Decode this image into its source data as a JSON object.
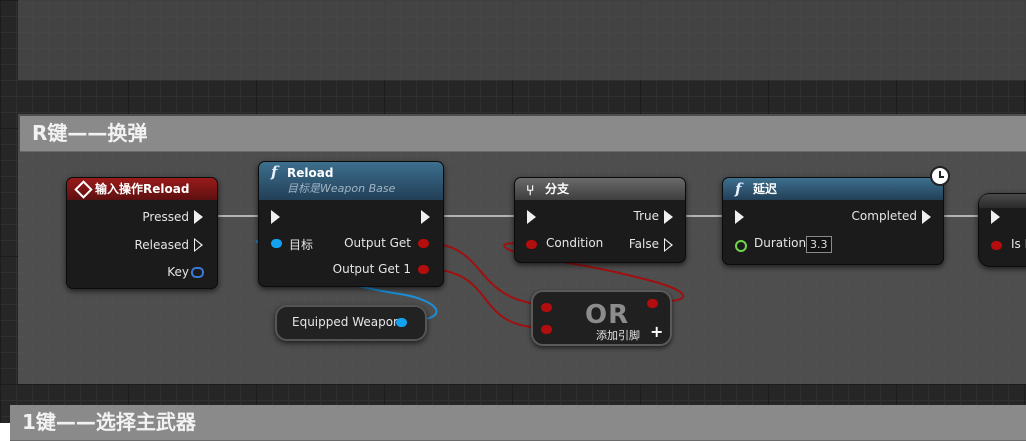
{
  "comments": [
    {
      "title": "R键——换弹"
    },
    {
      "title": "1键——选择主武器"
    }
  ],
  "nodes": {
    "input_action": {
      "title": "输入操作Reload",
      "pins": {
        "pressed": "Pressed",
        "released": "Released",
        "key": "Key"
      }
    },
    "reload": {
      "title": "Reload",
      "subtitle": "目标是Weapon Base",
      "pins": {
        "target": "目标",
        "output_get": "Output Get",
        "output_get_1": "Output Get 1"
      }
    },
    "equipped_weapon": {
      "label": "Equipped Weapon"
    },
    "branch": {
      "title": "分支",
      "pins": {
        "condition": "Condition",
        "true": "True",
        "false": "False"
      }
    },
    "or_node": {
      "title": "OR",
      "add_pin": "添加引脚"
    },
    "delay": {
      "title": "延迟",
      "pins": {
        "completed": "Completed",
        "duration": "Duration"
      },
      "duration_value": "3.3"
    },
    "partial_node": {
      "pin_label": "Is R"
    }
  },
  "colors": {
    "exec": "#f0f0f0",
    "bool_pin": "#b40d0d",
    "object_pin": "#13a1f0",
    "struct_pin": "#3a7ad6",
    "float_pin": "#6fd64c",
    "event_header": "#9b1b1b",
    "function_header": "#3d6f8e"
  },
  "icons": {
    "event": "diamond-event-icon",
    "function": "function-f-icon",
    "branch": "branch-icon",
    "latent": "clock-icon",
    "add": "plus-icon"
  }
}
